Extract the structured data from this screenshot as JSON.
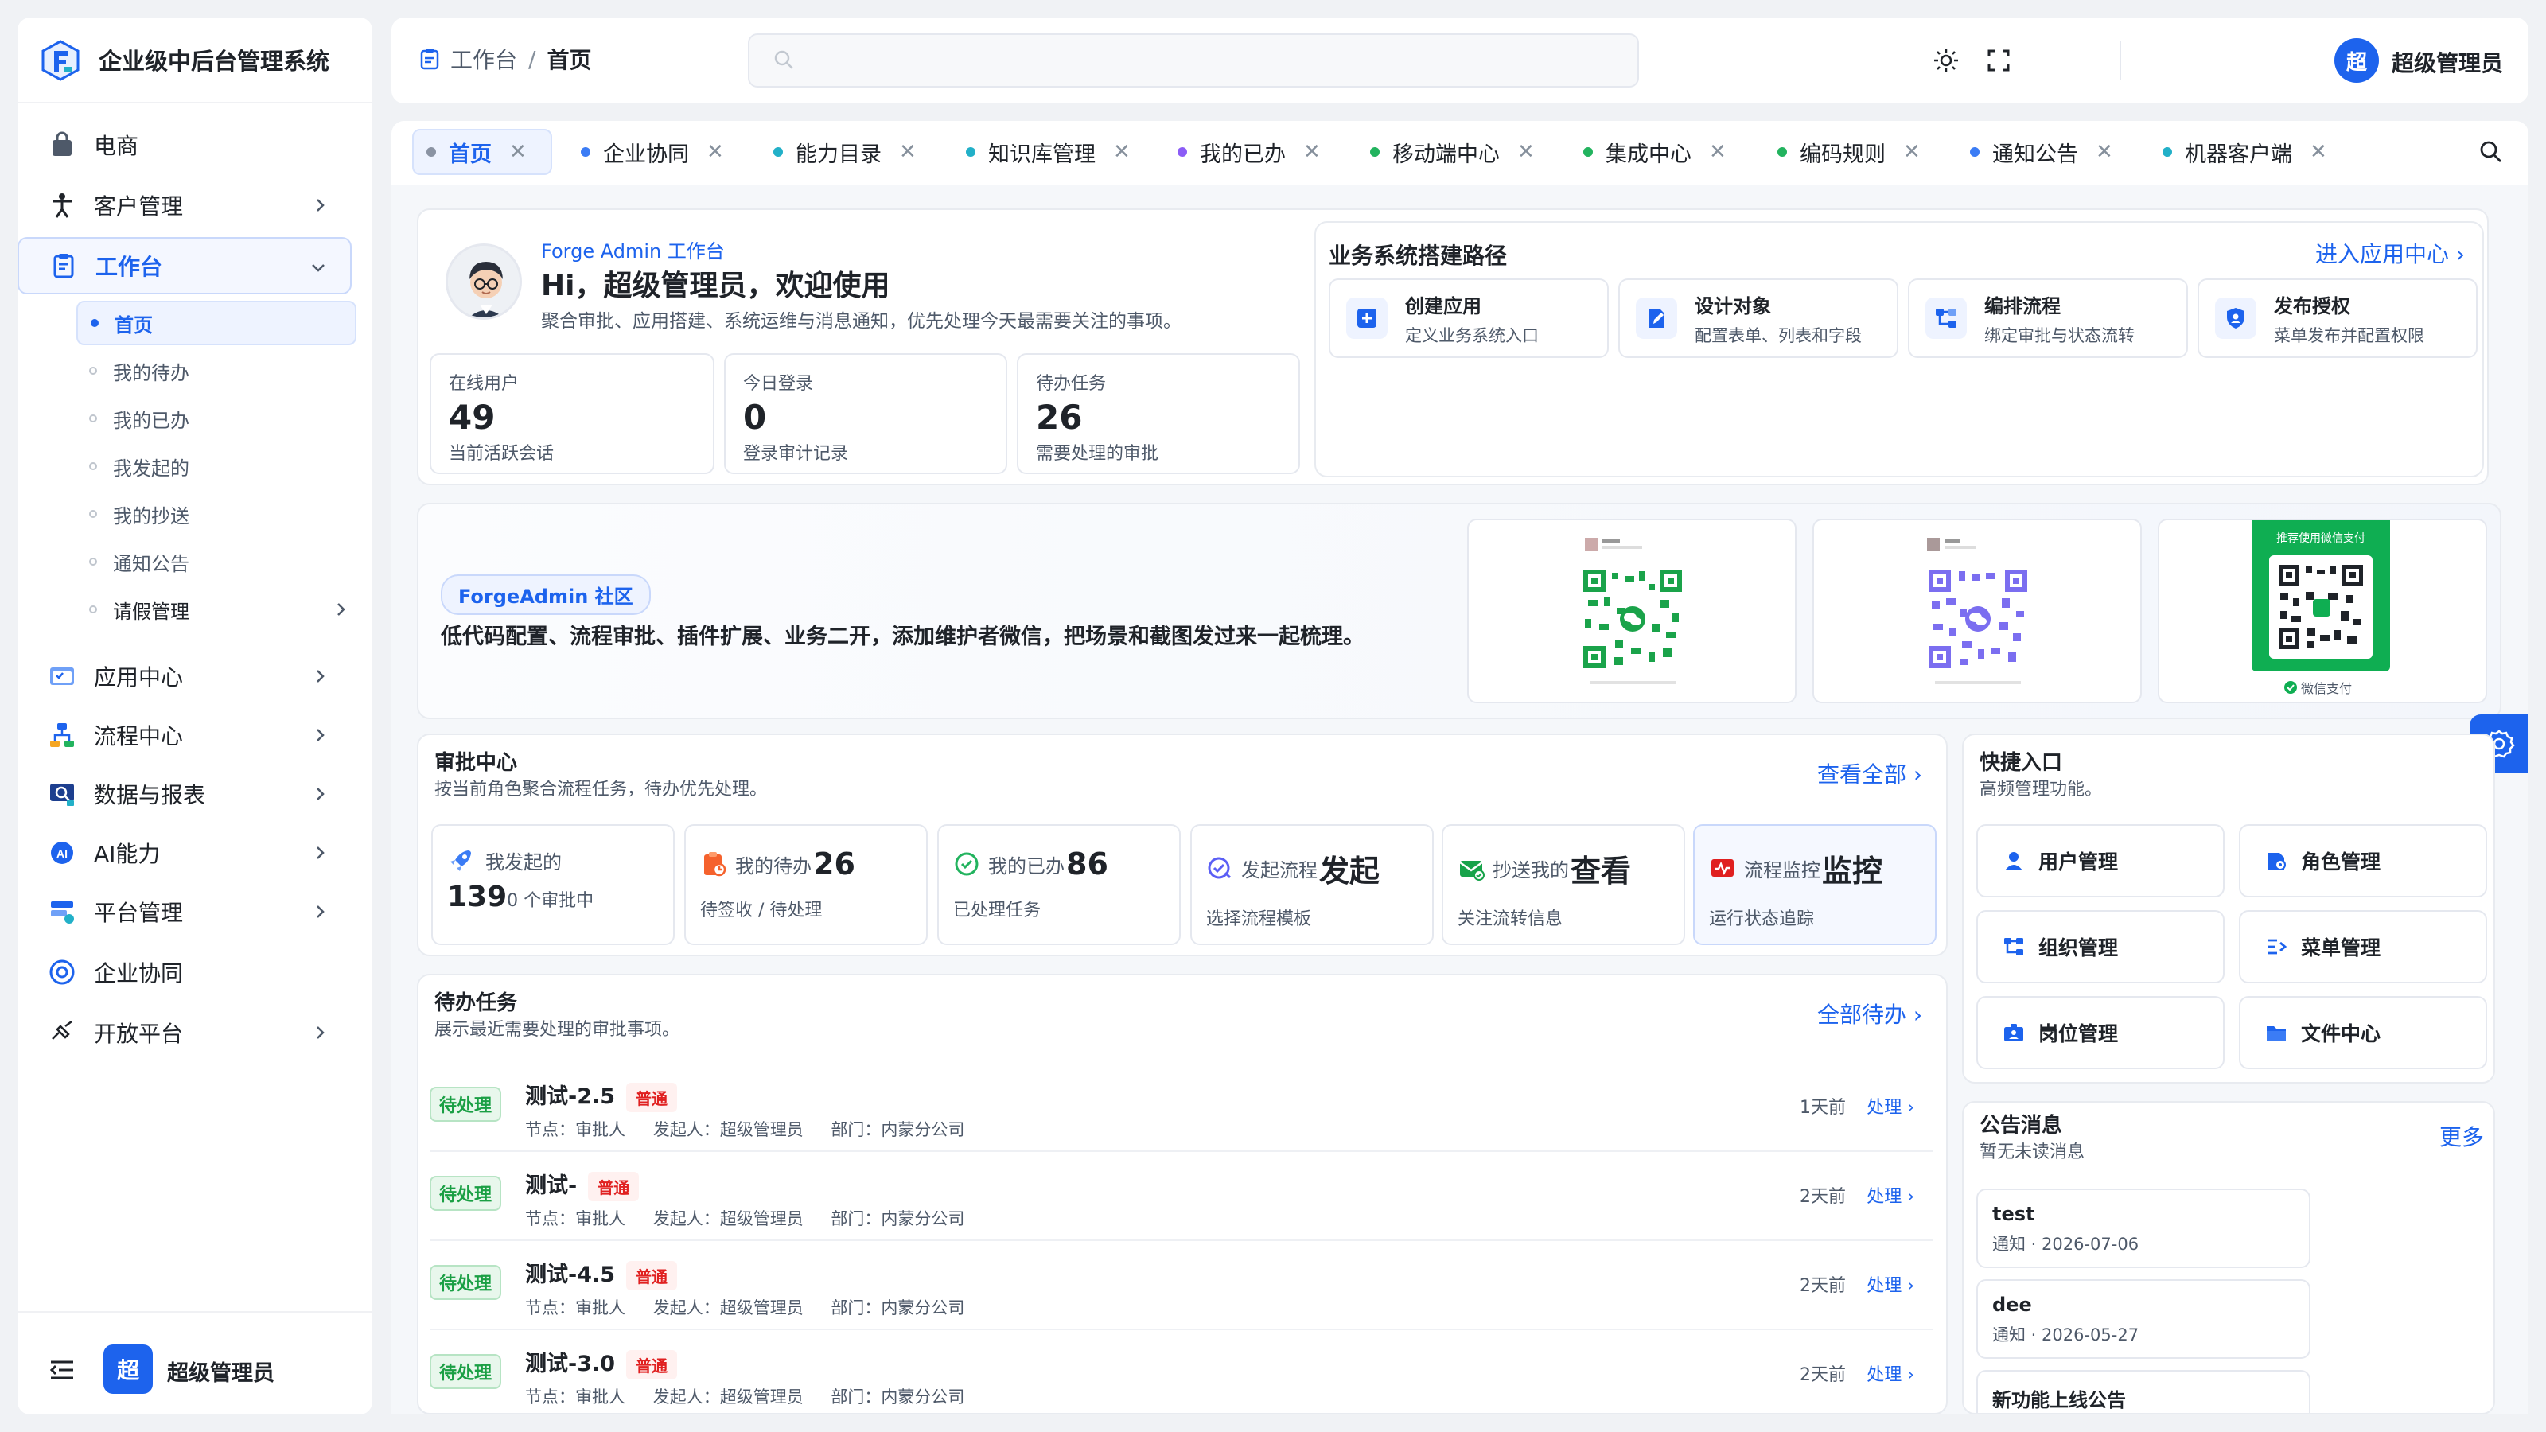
{
  "app": {
    "title": "企业级中后台管理系统"
  },
  "sidebar": {
    "items": [
      {
        "label": "电商"
      },
      {
        "label": "客户管理"
      },
      {
        "label": "工作台"
      },
      {
        "label": "应用中心"
      },
      {
        "label": "流程中心"
      },
      {
        "label": "数据与报表"
      },
      {
        "label": "AI能力"
      },
      {
        "label": "平台管理"
      },
      {
        "label": "企业协同"
      },
      {
        "label": "开放平台"
      }
    ],
    "sub_items": [
      {
        "label": "首页"
      },
      {
        "label": "我的待办"
      },
      {
        "label": "我的已办"
      },
      {
        "label": "我发起的"
      },
      {
        "label": "我的抄送"
      },
      {
        "label": "通知公告"
      },
      {
        "label": "请假管理"
      }
    ],
    "user": {
      "avatar": "超",
      "name": "超级管理员"
    }
  },
  "header": {
    "breadcrumb": {
      "parent": "工作台",
      "sep": "/",
      "current": "首页"
    },
    "search_placeholder": "",
    "user": {
      "avatar": "超",
      "name": "超级管理员"
    }
  },
  "tabs": [
    {
      "label": "首页",
      "color": "#8a93a3",
      "close": "✕"
    },
    {
      "label": "企业协同",
      "color": "#3b7cf5",
      "close": "✕"
    },
    {
      "label": "能力目录",
      "color": "#22b0c8",
      "close": "✕"
    },
    {
      "label": "知识库管理",
      "color": "#22b0c8",
      "close": "✕"
    },
    {
      "label": "我的已办",
      "color": "#8b5cf6",
      "close": "✕"
    },
    {
      "label": "移动端中心",
      "color": "#22b35e",
      "close": "✕"
    },
    {
      "label": "集成中心",
      "color": "#22b35e",
      "close": "✕"
    },
    {
      "label": "编码规则",
      "color": "#22b35e",
      "close": "✕"
    },
    {
      "label": "通知公告",
      "color": "#3b7cf5",
      "close": "✕"
    },
    {
      "label": "机器客户端",
      "color": "#22b0c8",
      "close": "✕"
    }
  ],
  "welcome": {
    "brand": "Forge Admin 工作台",
    "greeting": "Hi，超级管理员，欢迎使用",
    "desc": "聚合审批、应用搭建、系统运维与消息通知，优先处理今天最需要关注的事项。",
    "stats": [
      {
        "label": "在线用户",
        "value": "49",
        "desc": "当前活跃会话"
      },
      {
        "label": "今日登录",
        "value": "0",
        "desc": "登录审计记录"
      },
      {
        "label": "待办任务",
        "value": "26",
        "desc": "需要处理的审批"
      }
    ]
  },
  "path": {
    "title": "业务系统搭建路径",
    "link": "进入应用中心 ›",
    "steps": [
      {
        "title": "创建应用",
        "desc": "定义业务系统入口",
        "icon": "plus-icon"
      },
      {
        "title": "设计对象",
        "desc": "配置表单、列表和字段",
        "icon": "edit-icon"
      },
      {
        "title": "编排流程",
        "desc": "绑定审批与状态流转",
        "icon": "flow-icon"
      },
      {
        "title": "发布授权",
        "desc": "菜单发布并配置权限",
        "icon": "shield-icon"
      }
    ]
  },
  "community": {
    "badge": "ForgeAdmin 社区",
    "text": "低代码配置、流程审批、插件扩展、业务二开，添加维护者微信，把场景和截图发过来一起梳理。",
    "pay_top": "推荐使用微信支付",
    "pay_label": "微信支付"
  },
  "approval": {
    "title": "审批中心",
    "subtitle": "按当前角色聚合流程任务，待办优先处理。",
    "link": "查看全部 ›",
    "cards": [
      {
        "label": "我发起的",
        "value": "",
        "big": "139",
        "big_suffix": "0 个审批中",
        "desc": "",
        "icon": "rocket-icon",
        "color": "#3b7cf5"
      },
      {
        "label": "我的待办",
        "value": "26",
        "desc": "待签收 / 待处理",
        "icon": "clipboard-icon",
        "color": "#f5622d"
      },
      {
        "label": "我的已办",
        "value": "86",
        "desc": "已处理任务",
        "icon": "check-icon",
        "color": "#22b35e"
      },
      {
        "label": "发起流程",
        "value": "发起",
        "desc": "选择流程模板",
        "icon": "check-edit-icon",
        "color": "#5b5ff5"
      },
      {
        "label": "抄送我的",
        "value": "查看",
        "desc": "关注流转信息",
        "icon": "mail-icon",
        "color": "#17a34a"
      },
      {
        "label": "流程监控",
        "value": "监控",
        "desc": "运行状态追踪",
        "icon": "monitor-icon",
        "color": "#e02020"
      }
    ]
  },
  "todo": {
    "title": "待办任务",
    "subtitle": "展示最近需要处理的审批事项。",
    "link": "全部待办 ›",
    "items": [
      {
        "status": "待处理",
        "title": "测试-2.5",
        "priority": "普通",
        "node": "节点：审批人",
        "initiator": "发起人：超级管理员",
        "dept": "部门：内蒙分公司",
        "time": "1天前",
        "action": "处理 ›"
      },
      {
        "status": "待处理",
        "title": "测试-",
        "priority": "普通",
        "node": "节点：审批人",
        "initiator": "发起人：超级管理员",
        "dept": "部门：内蒙分公司",
        "time": "2天前",
        "action": "处理 ›"
      },
      {
        "status": "待处理",
        "title": "测试-4.5",
        "priority": "普通",
        "node": "节点：审批人",
        "initiator": "发起人：超级管理员",
        "dept": "部门：内蒙分公司",
        "time": "2天前",
        "action": "处理 ›"
      },
      {
        "status": "待处理",
        "title": "测试-3.0",
        "priority": "普通",
        "node": "节点：审批人",
        "initiator": "发起人：超级管理员",
        "dept": "部门：内蒙分公司",
        "time": "2天前",
        "action": "处理 ›"
      }
    ]
  },
  "quick": {
    "title": "快捷入口",
    "subtitle": "高频管理功能。",
    "items": [
      {
        "label": "用户管理"
      },
      {
        "label": "角色管理"
      },
      {
        "label": "组织管理"
      },
      {
        "label": "菜单管理"
      },
      {
        "label": "岗位管理"
      },
      {
        "label": "文件中心"
      }
    ]
  },
  "notices": {
    "title": "公告消息",
    "subtitle": "暂无未读消息",
    "link": "更多",
    "items": [
      {
        "title": "test",
        "meta": "通知 · 2026-07-06"
      },
      {
        "title": "dee",
        "meta": "通知 · 2026-05-27"
      },
      {
        "title": "新功能上线公告",
        "meta": ""
      }
    ]
  },
  "colors": {
    "primary": "#1d63ed",
    "bg": "#f0f2f5"
  }
}
